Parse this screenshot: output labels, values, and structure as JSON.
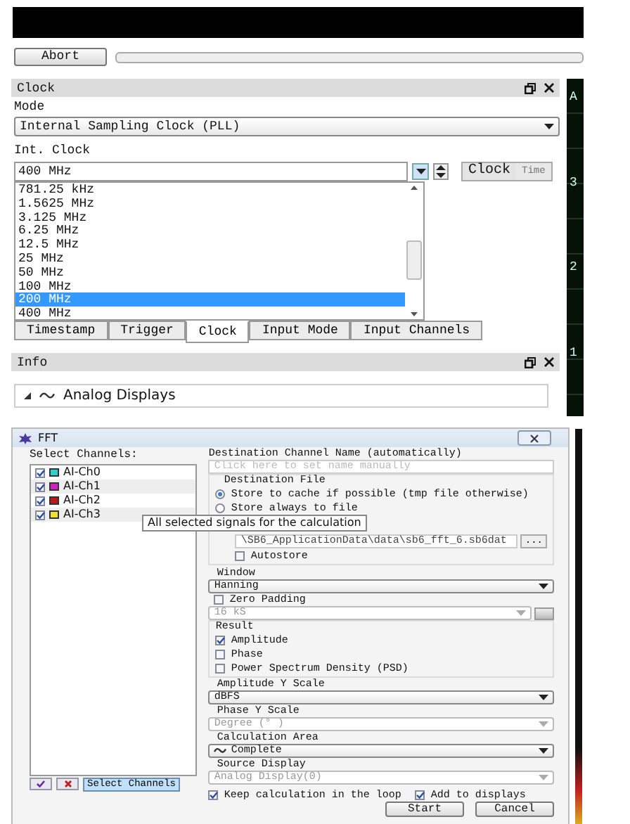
{
  "toolbar": {
    "abort_button": "Abort",
    "progress": {
      "level": 0
    }
  },
  "clock_panel": {
    "title": "Clock",
    "mode_label": "Mode",
    "mode_select": {
      "value": "Internal Sampling Clock (PLL)"
    },
    "int_clock_label": "Int. Clock",
    "int_clock_field": {
      "value": "400 MHz"
    },
    "unit_toggle": [
      {
        "label": "Clock",
        "selected": true
      },
      {
        "label": "Time",
        "selected": false
      }
    ],
    "dropdown_options": [
      {
        "label": "781.25 kHz",
        "selected": false
      },
      {
        "label": "1.5625 MHz",
        "selected": false
      },
      {
        "label": "3.125 MHz",
        "selected": false
      },
      {
        "label": "6.25 MHz",
        "selected": false
      },
      {
        "label": "12.5 MHz",
        "selected": false
      },
      {
        "label": "25 MHz",
        "selected": false
      },
      {
        "label": "50 MHz",
        "selected": false
      },
      {
        "label": "100 MHz",
        "selected": false
      },
      {
        "label": "200 MHz",
        "selected": true
      },
      {
        "label": "400 MHz",
        "selected": false
      }
    ]
  },
  "panel_tabs": [
    {
      "label": "Timestamp",
      "selected": false
    },
    {
      "label": "Trigger",
      "selected": false
    },
    {
      "label": "Clock",
      "selected": true
    },
    {
      "label": "Input Mode",
      "selected": false
    },
    {
      "label": "Input Channels",
      "selected": false
    }
  ],
  "info_panel": {
    "title": "Info",
    "tree": [
      {
        "label": "Analog Displays",
        "expanded": true
      }
    ]
  },
  "side_display": {
    "labels": [
      "A",
      "3",
      "2",
      "1"
    ]
  },
  "fft_dialog": {
    "title": "FFT",
    "channels_label": "Select Channels:",
    "channels": [
      {
        "label": "AI-Ch0",
        "checked": true,
        "color": "#30d0d0"
      },
      {
        "label": "AI-Ch1",
        "checked": true,
        "color": "#d020c0"
      },
      {
        "label": "AI-Ch2",
        "checked": true,
        "color": "#c01818"
      },
      {
        "label": "AI-Ch3",
        "checked": true,
        "color": "#f0e030"
      }
    ],
    "select_button": "Select Channels",
    "tooltip": "All selected signals for the calculation",
    "destination_name": {
      "label": "Destination Channel Name (automatically)",
      "placeholder": "Click here to set name manually"
    },
    "destination_file": {
      "label": "Destination File",
      "options": [
        {
          "label": "Store to cache if possible (tmp file otherwise)",
          "selected": true
        },
        {
          "label": "Store always to file",
          "selected": false
        }
      ],
      "path": "\\SB6_ApplicationData\\data\\sb6_fft_6.sb6dat",
      "browse_button": "...",
      "autostore": {
        "label": "Autostore",
        "checked": false
      }
    },
    "window": {
      "label": "Window",
      "value": "Hanning",
      "disabled": false
    },
    "zero_padding": {
      "label": "Zero Padding",
      "checked": false,
      "value": "16 kS",
      "disabled": true
    },
    "result": {
      "label": "Result",
      "options": [
        {
          "label": "Amplitude",
          "checked": true
        },
        {
          "label": "Phase",
          "checked": false
        },
        {
          "label": "Power Spectrum Density (PSD)",
          "checked": false
        }
      ]
    },
    "scales": [
      {
        "label": "Amplitude Y Scale",
        "value": "dBFS",
        "disabled": false,
        "kind": "plain"
      },
      {
        "label": "Phase Y Scale",
        "value": "Degree (° )",
        "disabled": true,
        "kind": "plain"
      },
      {
        "label": "Calculation Area",
        "value": "Complete",
        "disabled": false,
        "kind": "wave"
      },
      {
        "label": "Source Display",
        "value": "Analog Display(0)",
        "disabled": true,
        "kind": "plain"
      }
    ],
    "options": [
      {
        "label": "Keep calculation in the loop",
        "checked": true
      },
      {
        "label": "Add to displays",
        "checked": true
      }
    ],
    "buttons": [
      "Start",
      "Cancel"
    ]
  }
}
